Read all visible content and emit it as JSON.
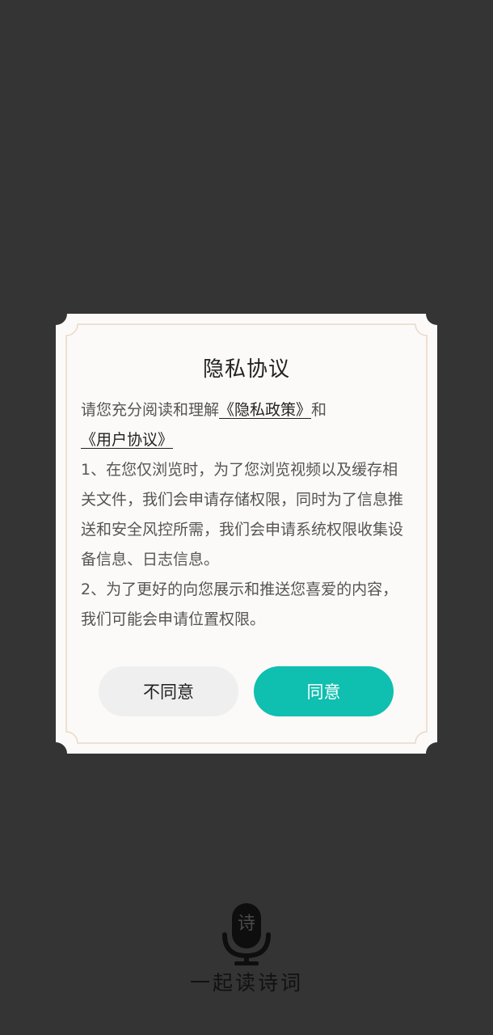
{
  "dialog": {
    "title": "隐私协议",
    "intro_prefix": "请您充分阅读和理解",
    "privacy_policy_link": "《隐私政策》",
    "intro_and": "和",
    "user_agreement_link": "《用户协议》",
    "clause_1": "1、在您仅浏览时，为了您浏览视频以及缓存相关文件，我们会申请存储权限，同时为了信息推送和安全风控所需，我们会申请系统权限收集设备信息、日志信息。",
    "clause_2": "2、为了更好的向您展示和推送您喜爱的内容，我们可能会申请位置权限。",
    "disagree_label": "不同意",
    "agree_label": "同意"
  },
  "footer": {
    "logo_icon": "microphone-poem-logo-icon",
    "logo_char": "诗",
    "app_name": "一起读诗词"
  },
  "colors": {
    "background": "#343434",
    "dialog": "#fbfaf8",
    "border": "#ead8c6",
    "accent": "#0fbfaf",
    "disagree_button": "#efefef"
  }
}
